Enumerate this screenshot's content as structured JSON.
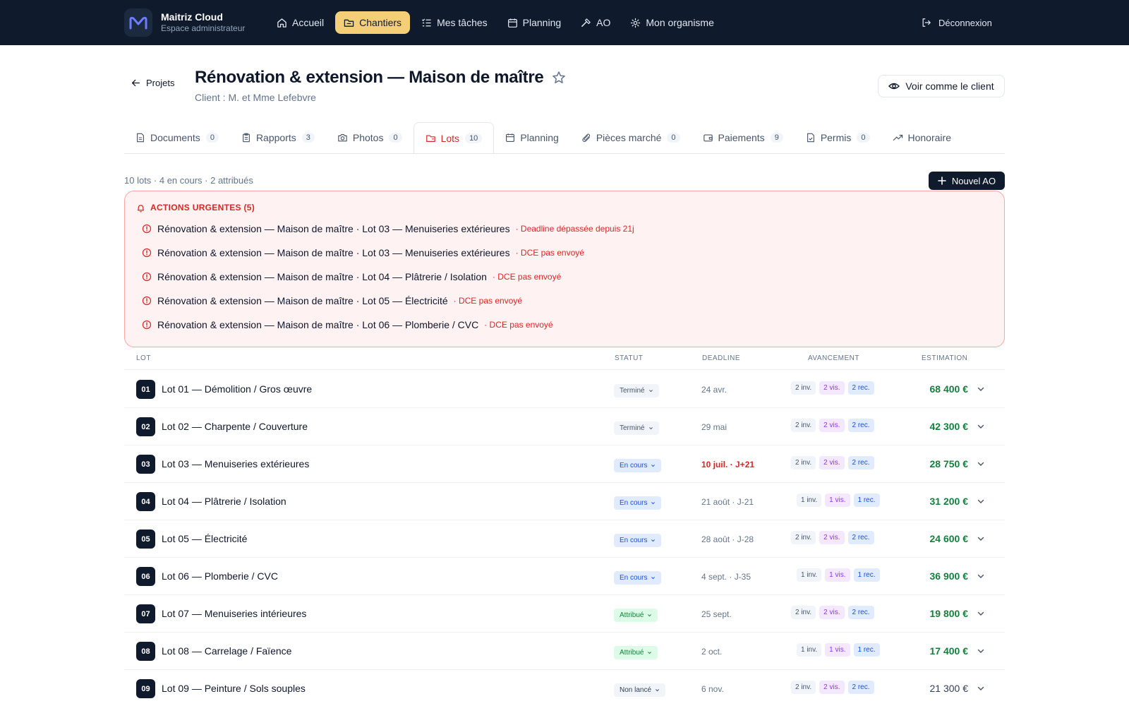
{
  "app": {
    "name": "Maitriz Cloud",
    "subtitle": "Espace administrateur"
  },
  "nav": {
    "items": [
      {
        "label": "Accueil",
        "icon": "home-icon"
      },
      {
        "label": "Chantiers",
        "icon": "folder-icon",
        "active": true
      },
      {
        "label": "Mes tâches",
        "icon": "tasks-icon"
      },
      {
        "label": "Planning",
        "icon": "calendar-icon"
      },
      {
        "label": "AO",
        "icon": "hammer-icon"
      },
      {
        "label": "Mon organisme",
        "icon": "gear-icon"
      }
    ],
    "logout": "Déconnexion"
  },
  "header": {
    "back": "Projets",
    "title": "Rénovation & extension — Maison de maître",
    "client": "Client : M. et Mme Lefebvre",
    "view_client": "Voir comme le client"
  },
  "tabs": [
    {
      "label": "Documents",
      "count": "0",
      "icon": "document-icon"
    },
    {
      "label": "Rapports",
      "count": "3",
      "icon": "clipboard-icon"
    },
    {
      "label": "Photos",
      "count": "0",
      "icon": "camera-icon"
    },
    {
      "label": "Lots",
      "count": "10",
      "icon": "folder-icon",
      "active": true
    },
    {
      "label": "Planning",
      "count": "",
      "icon": "calendar-icon"
    },
    {
      "label": "Pièces marché",
      "count": "0",
      "icon": "paperclip-icon"
    },
    {
      "label": "Paiements",
      "count": "9",
      "icon": "wallet-icon"
    },
    {
      "label": "Permis",
      "count": "0",
      "icon": "file-check-icon"
    },
    {
      "label": "Honoraire",
      "count": "",
      "icon": "trend-icon"
    }
  ],
  "summary": "10 lots · 4 en cours · 2 attribués",
  "new_ao": "Nouvel AO",
  "urgent": {
    "title": "ACTIONS URGENTES (5)",
    "items": [
      {
        "text": "Rénovation & extension — Maison de maître · Lot 03 — Menuiseries extérieures",
        "note": "· Deadline dépassée depuis 21j"
      },
      {
        "text": "Rénovation & extension — Maison de maître · Lot 03 — Menuiseries extérieures",
        "note": "· DCE pas envoyé"
      },
      {
        "text": "Rénovation & extension — Maison de maître · Lot 04 — Plâtrerie / Isolation",
        "note": "· DCE pas envoyé"
      },
      {
        "text": "Rénovation & extension — Maison de maître · Lot 05 — Électricité",
        "note": "· DCE pas envoyé"
      },
      {
        "text": "Rénovation & extension — Maison de maître · Lot 06 — Plomberie / CVC",
        "note": "· DCE pas envoyé"
      }
    ]
  },
  "table": {
    "headers": {
      "lot": "LOT",
      "status": "STATUT",
      "deadline": "DEADLINE",
      "progress": "AVANCEMENT",
      "estimate": "ESTIMATION"
    },
    "rows": [
      {
        "num": "01",
        "name": "Lot 01 — Démolition / Gros œuvre",
        "status": "Terminé",
        "kind": "done",
        "deadline": "24 avr.",
        "late": false,
        "inv": "2 inv.",
        "vis": "2 vis.",
        "rec": "2 rec.",
        "est": "68 400 €",
        "estColor": "green"
      },
      {
        "num": "02",
        "name": "Lot 02 — Charpente / Couverture",
        "status": "Terminé",
        "kind": "done",
        "deadline": "29 mai",
        "late": false,
        "inv": "2 inv.",
        "vis": "2 vis.",
        "rec": "2 rec.",
        "est": "42 300 €",
        "estColor": "green"
      },
      {
        "num": "03",
        "name": "Lot 03 — Menuiseries extérieures",
        "status": "En cours",
        "kind": "run",
        "deadline": "10 juil. · J+21",
        "late": true,
        "inv": "2 inv.",
        "vis": "2 vis.",
        "rec": "2 rec.",
        "est": "28 750 €",
        "estColor": "green"
      },
      {
        "num": "04",
        "name": "Lot 04 — Plâtrerie / Isolation",
        "status": "En cours",
        "kind": "run",
        "deadline": "21 août · J-21",
        "late": false,
        "inv": "1 inv.",
        "vis": "1 vis.",
        "rec": "1 rec.",
        "est": "31 200 €",
        "estColor": "green"
      },
      {
        "num": "05",
        "name": "Lot 05 — Électricité",
        "status": "En cours",
        "kind": "run",
        "deadline": "28 août · J-28",
        "late": false,
        "inv": "2 inv.",
        "vis": "2 vis.",
        "rec": "2 rec.",
        "est": "24 600 €",
        "estColor": "green"
      },
      {
        "num": "06",
        "name": "Lot 06 — Plomberie / CVC",
        "status": "En cours",
        "kind": "run",
        "deadline": "4 sept. · J-35",
        "late": false,
        "inv": "1 inv.",
        "vis": "1 vis.",
        "rec": "1 rec.",
        "est": "36 900 €",
        "estColor": "green"
      },
      {
        "num": "07",
        "name": "Lot 07 — Menuiseries intérieures",
        "status": "Attribué",
        "kind": "att",
        "deadline": "25 sept.",
        "late": false,
        "inv": "2 inv.",
        "vis": "2 vis.",
        "rec": "2 rec.",
        "est": "19 800 €",
        "estColor": "green"
      },
      {
        "num": "08",
        "name": "Lot 08 — Carrelage / Faïence",
        "status": "Attribué",
        "kind": "att",
        "deadline": "2 oct.",
        "late": false,
        "inv": "1 inv.",
        "vis": "1 vis.",
        "rec": "1 rec.",
        "est": "17 400 €",
        "estColor": "green"
      },
      {
        "num": "09",
        "name": "Lot 09 — Peinture / Sols souples",
        "status": "Non lancé",
        "kind": "none",
        "deadline": "6 nov.",
        "late": false,
        "inv": "2 inv.",
        "vis": "2 vis.",
        "rec": "2 rec.",
        "est": "21 300 €",
        "estColor": "neutral"
      }
    ]
  },
  "colors": {
    "navbar": "#0f1b2d",
    "accent": "#f5cf78",
    "danger": "#dc2626",
    "success": "#15803d"
  }
}
